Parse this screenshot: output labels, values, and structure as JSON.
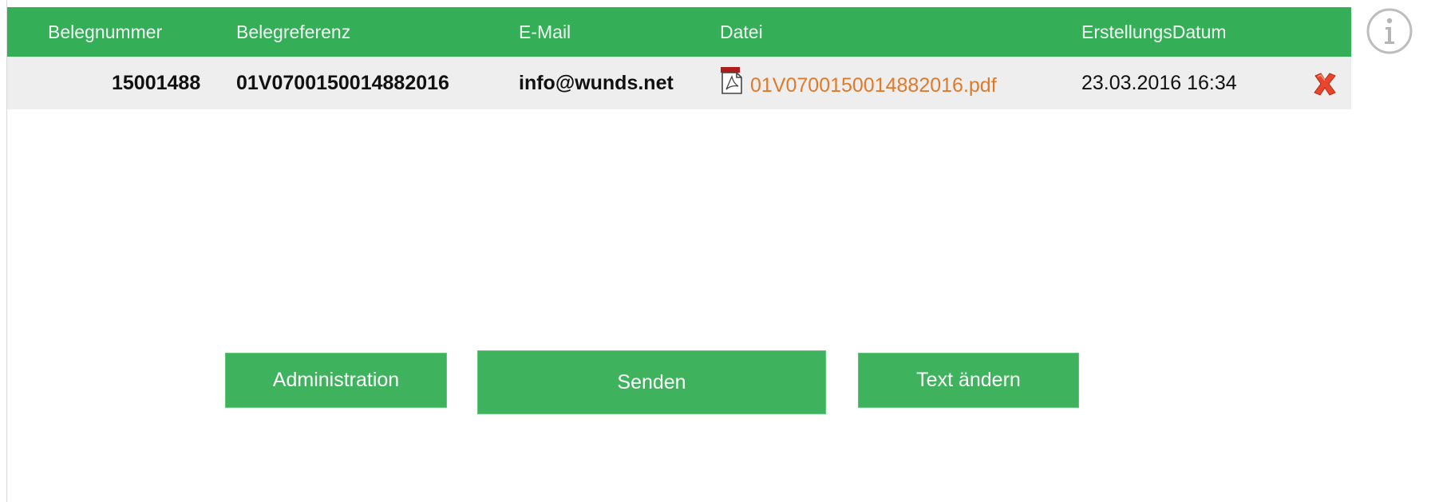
{
  "table": {
    "headers": {
      "belegnummer": "Belegnummer",
      "belegreferenz": "Belegreferenz",
      "email": "E-Mail",
      "datei": "Datei",
      "erstellungsdatum": "ErstellungsDatum"
    },
    "rows": [
      {
        "belegnummer": "15001488",
        "belegreferenz": "01V0700150014882016",
        "email": "info@wunds.net",
        "datei": "01V0700150014882016.pdf",
        "erstellungsdatum": "23.03.2016 16:34"
      }
    ]
  },
  "buttons": {
    "administration": "Administration",
    "senden": "Senden",
    "text_aendern": "Text ändern"
  },
  "icons": {
    "file": "pdf-icon",
    "delete": "delete-icon",
    "info": "info-icon"
  },
  "colors": {
    "header_bg": "#34ae57",
    "button_bg": "#3eb25c",
    "row_bg": "#eeeeee",
    "link": "#e07a2a",
    "delete": "#e8452c"
  }
}
